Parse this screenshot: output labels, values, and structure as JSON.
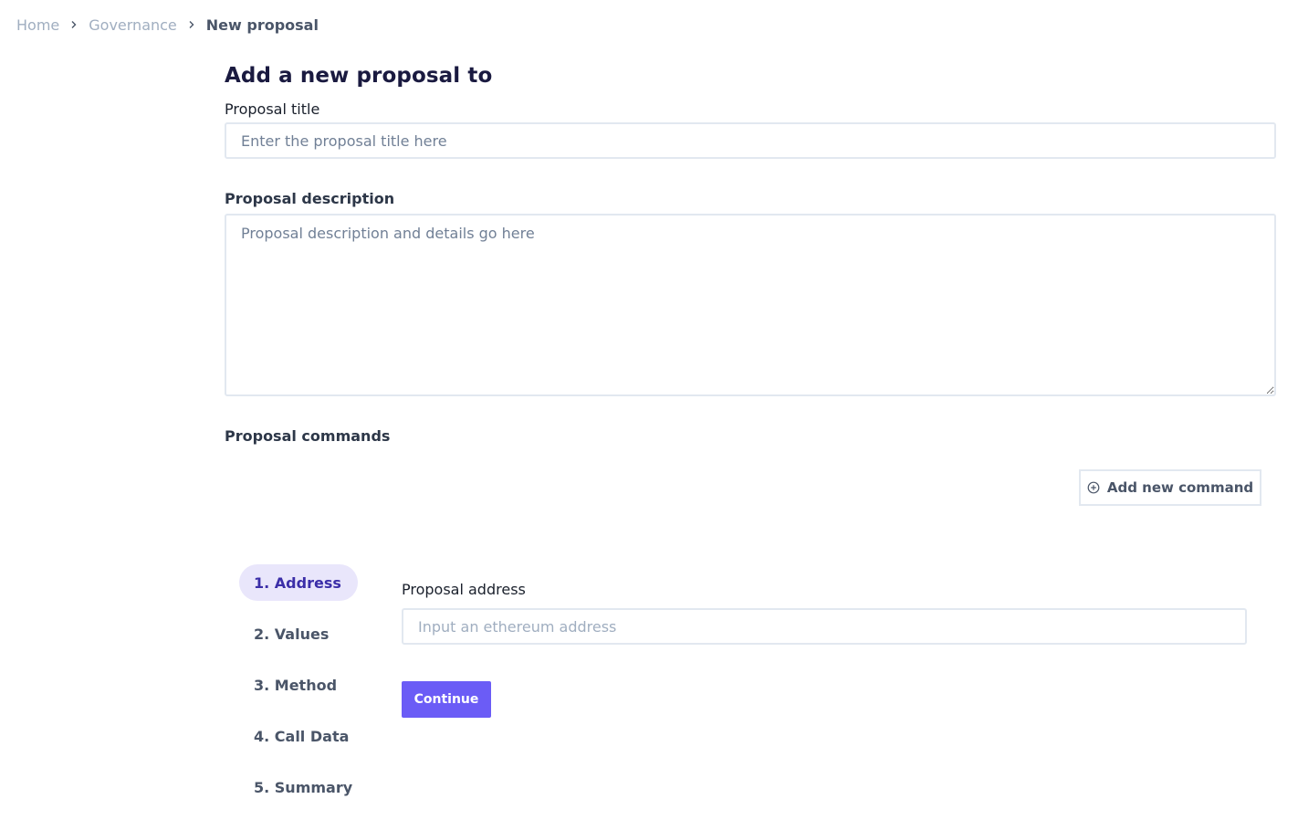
{
  "breadcrumb": {
    "items": [
      {
        "label": "Home"
      },
      {
        "label": "Governance"
      },
      {
        "label": "New proposal"
      }
    ]
  },
  "page": {
    "title": "Add a new proposal to"
  },
  "form": {
    "title_label": "Proposal title",
    "title_placeholder": "Enter the proposal title here",
    "title_value": "",
    "description_label": "Proposal description",
    "description_placeholder": "Proposal description and details go here",
    "description_value": "",
    "commands_label": "Proposal commands",
    "add_command_label": "Add new command"
  },
  "wizard": {
    "steps": [
      {
        "label": "1. Address",
        "active": true
      },
      {
        "label": "2. Values",
        "active": false
      },
      {
        "label": "3. Method",
        "active": false
      },
      {
        "label": "4. Call Data",
        "active": false
      },
      {
        "label": "5. Summary",
        "active": false
      }
    ],
    "address_label": "Proposal address",
    "address_placeholder": "Input an ethereum address",
    "address_value": "",
    "continue_label": "Continue"
  },
  "colors": {
    "accent": "#6b5cf6",
    "active_step_bg": "#e9e6fb",
    "active_step_text": "#3b2ea8",
    "title_color": "#1a1a40"
  },
  "icons": {
    "breadcrumb_separator": "chevron-right-icon",
    "add_command": "plus-circle-icon"
  }
}
